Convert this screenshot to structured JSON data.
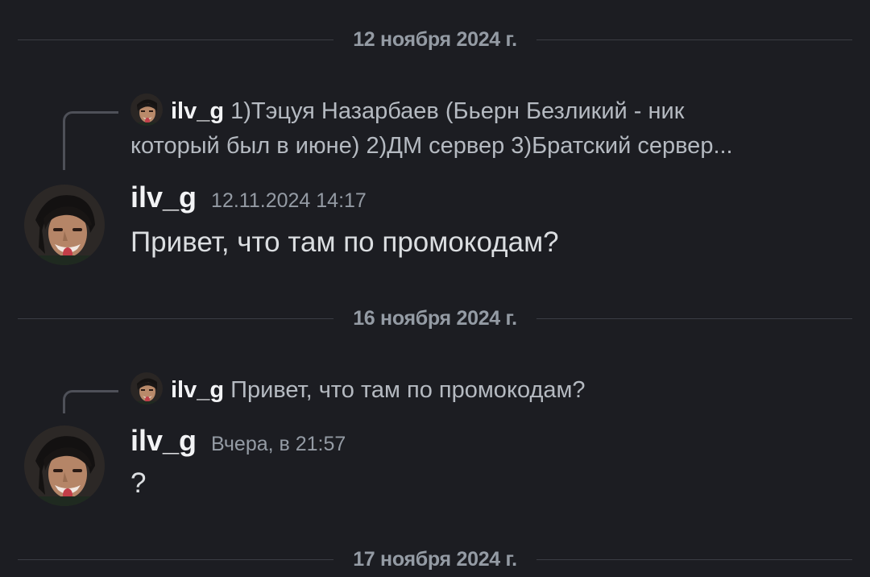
{
  "date_dividers": [
    {
      "label": "12 ноября 2024 г."
    },
    {
      "label": "16 ноября 2024 г."
    },
    {
      "label": "17 ноября 2024 г."
    }
  ],
  "messages": [
    {
      "reply": {
        "author": "ilv_g",
        "line1": "1)Тэцуя Назарбаев (Бьерн Безликий - ник",
        "line2": "который был в июне) 2)ДМ сервер 3)Братский сервер..."
      },
      "author": "ilv_g",
      "timestamp": "12.11.2024 14:17",
      "text": "Привет, что там по промокодам?",
      "avatar_icon": "user-avatar"
    },
    {
      "reply": {
        "author": "ilv_g",
        "line1": "Привет, что там по промокодам?"
      },
      "author": "ilv_g",
      "timestamp": "Вчера, в 21:57",
      "text": "?",
      "avatar_icon": "user-avatar"
    }
  ],
  "colors": {
    "background": "#1c1d22",
    "muted_text": "#949ba4",
    "reply_text": "#b5bac1",
    "author": "#f2f3f5",
    "divider_line": "#3b3d44"
  }
}
